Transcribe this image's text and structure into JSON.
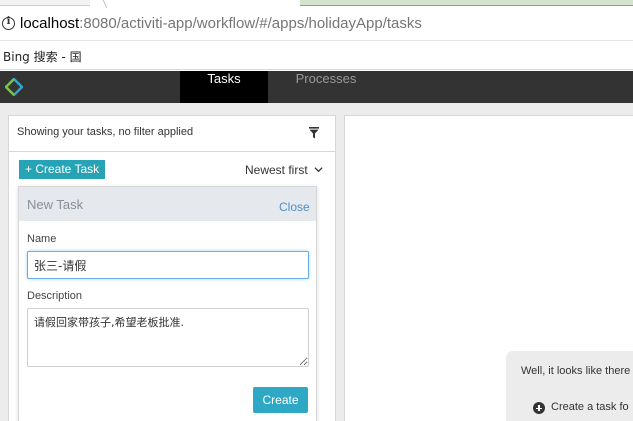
{
  "browser": {
    "url_host": "localhost",
    "url_rest": ":8080/activiti-app/workflow/#/apps/holidayApp/tasks",
    "bookmark": "Bing 搜索 - 国"
  },
  "nav": {
    "tabs": [
      {
        "label": "Tasks",
        "active": true
      },
      {
        "label": "Processes",
        "active": false
      }
    ]
  },
  "task_list": {
    "filter_text": "Showing your tasks, no filter applied",
    "create_task_label": "+ Create Task",
    "sort_label": "Newest first"
  },
  "new_task": {
    "title": "New Task",
    "close_label": "Close",
    "name_label": "Name",
    "name_value": "张三-请假",
    "description_label": "Description",
    "description_value": "请假回家带孩子,希望老板批准.",
    "create_label": "Create"
  },
  "empty_state": {
    "message": "Well, it looks like there",
    "link": "Create a task fo"
  },
  "colors": {
    "accent": "#27a3b6",
    "nav_bg": "#333333",
    "nav_active": "#000000",
    "link": "#4e8fc5"
  }
}
